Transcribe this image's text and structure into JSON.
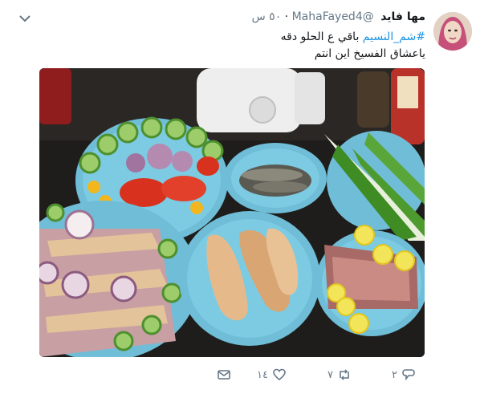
{
  "tweet": {
    "name": "مها فايد",
    "handle": "@MahaFayed4",
    "time": "٥٠ س",
    "hashtag": "#شم_النسيم",
    "line1_rest": " باقي ع الحلو دقه",
    "line2": "ياعشاق الفسيخ اين انتم"
  },
  "actions": {
    "reply_count": "٢",
    "retweet_count": "٧",
    "like_count": "١٤"
  },
  "icons": {
    "more": "chevron-down-icon",
    "reply": "reply-icon",
    "retweet": "retweet-icon",
    "like": "heart-icon",
    "message": "envelope-icon"
  },
  "colors": {
    "link": "#1b95e0",
    "muted": "#657786",
    "text": "#14171a"
  }
}
